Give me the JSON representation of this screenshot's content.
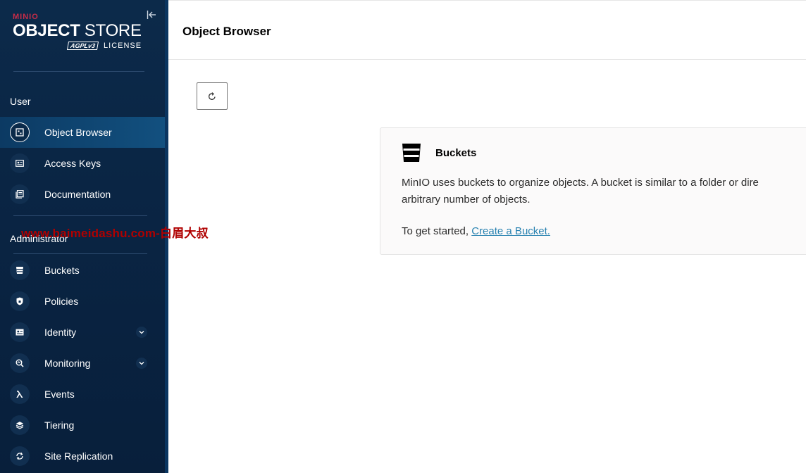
{
  "sidebar": {
    "logo": {
      "brand": "MINIO",
      "product_bold": "OBJECT",
      "product_light": " STORE",
      "agpl": "AGPLv3",
      "license": "LICENSE"
    },
    "sections": {
      "user": "User",
      "admin": "Administrator"
    },
    "user_items": [
      {
        "label": "Object Browser"
      },
      {
        "label": "Access Keys"
      },
      {
        "label": "Documentation"
      }
    ],
    "admin_items": [
      {
        "label": "Buckets"
      },
      {
        "label": "Policies"
      },
      {
        "label": "Identity"
      },
      {
        "label": "Monitoring"
      },
      {
        "label": "Events"
      },
      {
        "label": "Tiering"
      },
      {
        "label": "Site Replication"
      }
    ]
  },
  "header": {
    "title": "Object Browser"
  },
  "info": {
    "title": "Buckets",
    "line1": "MinIO uses buckets to organize objects. A bucket is similar to a folder or dire",
    "line2": "arbitrary number of objects.",
    "cta_prefix": "To get started, ",
    "cta_link": "Create a Bucket."
  },
  "watermark": "www.baimeidashu.com-白眉大叔",
  "colors": {
    "sidebar_bg": "#0c2a4a",
    "active_bg": "#12507f",
    "brand_red": "#c72c48",
    "link": "#2781b0"
  }
}
